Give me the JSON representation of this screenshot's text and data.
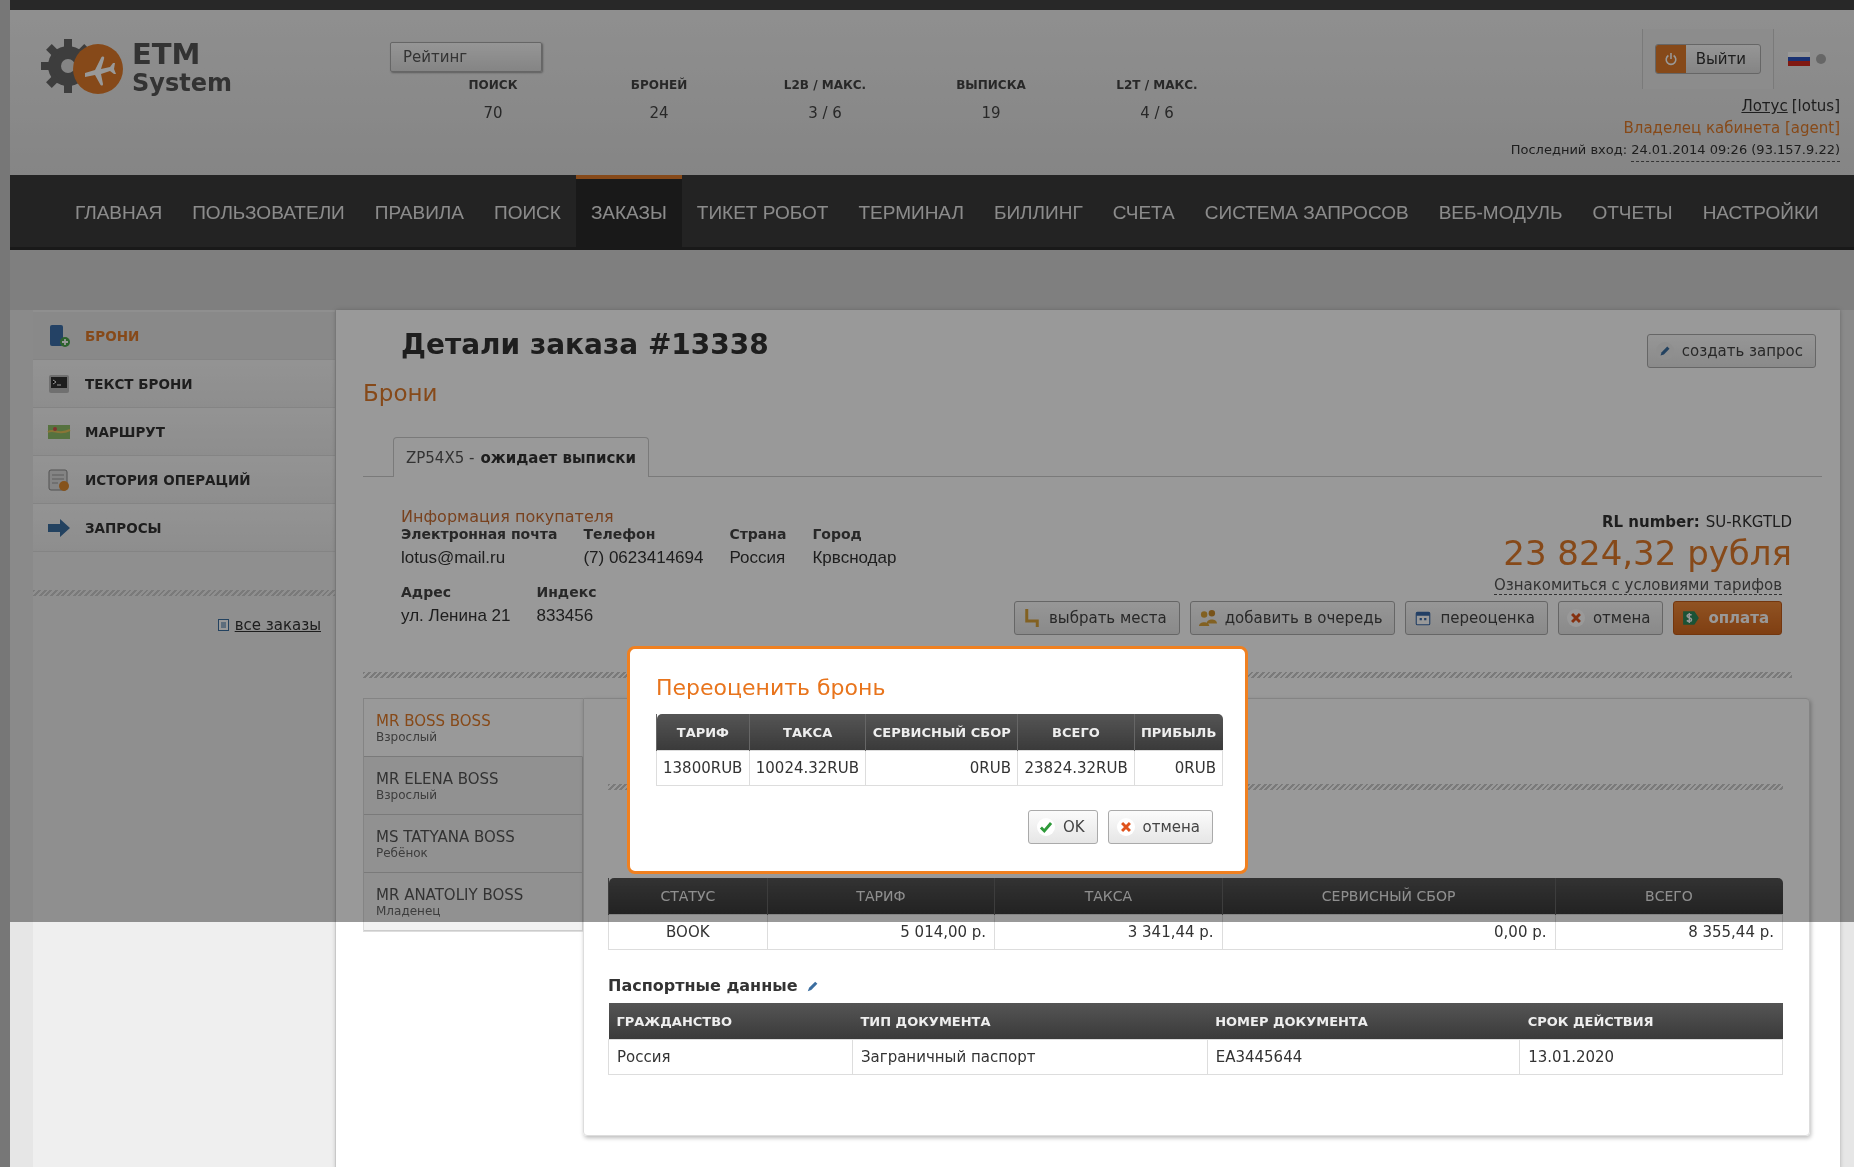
{
  "header": {
    "logo": {
      "line1": "ETM",
      "line2": "System"
    },
    "rating_button": "Рейтинг",
    "stats": [
      {
        "label": "ПОИСК",
        "value": "70"
      },
      {
        "label": "БРОНЕЙ",
        "value": "24"
      },
      {
        "label": "L2B / МАКС.",
        "value": "3 / 6"
      },
      {
        "label": "ВЫПИСКА",
        "value": "19"
      },
      {
        "label": "L2T / МАКС.",
        "value": "4 / 6"
      }
    ],
    "logout_button": "Выйти",
    "user": {
      "name": "Лотус",
      "login": "[lotus]",
      "role": "Владелец кабинета [agent]",
      "last_login_label": "Последний вход:",
      "last_login_value": "24.01.2014 09:26 (93.157.9.22)"
    }
  },
  "nav": [
    {
      "label": "ГЛАВНАЯ",
      "selected": false
    },
    {
      "label": "ПОЛЬЗОВАТЕЛИ",
      "selected": false
    },
    {
      "label": "ПРАВИЛА",
      "selected": false
    },
    {
      "label": "ПОИСК",
      "selected": false
    },
    {
      "label": "ЗАКАЗЫ",
      "selected": true
    },
    {
      "label": "ТИКЕТ РОБОТ",
      "selected": false
    },
    {
      "label": "ТЕРМИНАЛ",
      "selected": false
    },
    {
      "label": "БИЛЛИНГ",
      "selected": false
    },
    {
      "label": "СЧЕТА",
      "selected": false
    },
    {
      "label": "СИСТЕМА ЗАПРОСОВ",
      "selected": false
    },
    {
      "label": "ВЕБ-МОДУЛЬ",
      "selected": false
    },
    {
      "label": "ОТЧЕТЫ",
      "selected": false
    },
    {
      "label": "НАСТРОЙКИ",
      "selected": false
    }
  ],
  "sidebar": {
    "items": [
      {
        "label": "БРОНИ",
        "selected": true
      },
      {
        "label": "ТЕКСТ БРОНИ",
        "selected": false
      },
      {
        "label": "МАРШРУТ",
        "selected": false
      },
      {
        "label": "ИСТОРИЯ ОПЕРАЦИЙ",
        "selected": false
      },
      {
        "label": "ЗАПРОСЫ",
        "selected": false
      }
    ],
    "all_orders_link": "все заказы"
  },
  "order": {
    "title": "Детали заказа #13338",
    "create_request_button": "создать запрос",
    "section": "Брони",
    "tabs": [
      {
        "code": "ZP54X5 -",
        "status": "ожидает выписки",
        "selected": true
      }
    ],
    "buyer": {
      "title": "Информация покупателя",
      "rows": [
        [
          {
            "label": "Электронная почта",
            "value": "lotus@mail.ru"
          },
          {
            "label": "Телефон",
            "value": "(7) 0623414694"
          },
          {
            "label": "Страна",
            "value": "Россия"
          },
          {
            "label": "Город",
            "value": "Крвснодар"
          }
        ],
        [
          {
            "label": "Адрес",
            "value": "ул. Ленина 21"
          },
          {
            "label": "Индекс",
            "value": "833456"
          }
        ]
      ]
    },
    "rl_label": "RL number:",
    "rl_value": "SU-RKGTLD",
    "price": "23 824,32 рубля",
    "tariff_link": "Ознакомиться с условиями тарифов",
    "actions": [
      {
        "label": "выбрать места",
        "kind": "seats"
      },
      {
        "label": "добавить в очередь",
        "kind": "queue"
      },
      {
        "label": "переоценка",
        "kind": "reprice"
      },
      {
        "label": "отмена",
        "kind": "cancel"
      },
      {
        "label": "оплата",
        "kind": "pay"
      }
    ],
    "passengers": [
      {
        "name": "MR BOSS BOSS",
        "type": "Взрослый",
        "selected": true
      },
      {
        "name": "MR ELENA BOSS",
        "type": "Взрослый",
        "selected": false
      },
      {
        "name": "MS TATYANA BOSS",
        "type": "Ребёнок",
        "selected": false
      },
      {
        "name": "MR ANATOLIY BOSS",
        "type": "Младенец",
        "selected": false
      }
    ],
    "fare_table": {
      "columns": [
        "СТАТУС",
        "ТАРИФ",
        "ТАКСА",
        "СЕРВИСНЫЙ СБОР",
        "ВСЕГО"
      ],
      "rows": [
        [
          "BOOK",
          "5 014,00 р.",
          "3 341,44 р.",
          "0,00 р.",
          "8 355,44 р."
        ]
      ]
    },
    "passport": {
      "title": "Паспортные данные",
      "columns": [
        "ГРАЖДАНСТВО",
        "ТИП ДОКУМЕНТА",
        "НОМЕР ДОКУМЕНТА",
        "СРОК ДЕЙСТВИЯ"
      ],
      "rows": [
        [
          "Россия",
          "Заграничный паспорт",
          "EA3445644",
          "13.01.2020"
        ]
      ]
    }
  },
  "modal": {
    "title": "Переоценить бронь",
    "columns": [
      "ТАРИФ",
      "ТАКСА",
      "СЕРВИСНЫЙ СБОР",
      "ВСЕГО",
      "ПРИБЫЛЬ"
    ],
    "rows": [
      [
        "13800RUB",
        "10024.32RUB",
        "0RUB",
        "23824.32RUB",
        "0RUB"
      ]
    ],
    "buttons": [
      {
        "label": "OK",
        "kind": "ok"
      },
      {
        "label": "отмена",
        "kind": "cancel"
      }
    ]
  }
}
